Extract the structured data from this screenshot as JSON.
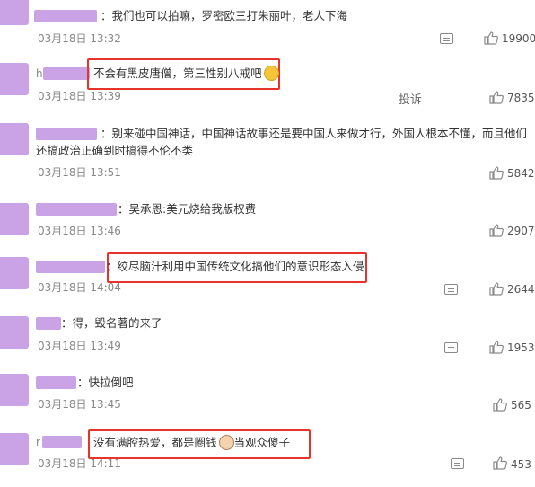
{
  "comments": [
    {
      "name_prefix": "",
      "text": "我们也可以拍嘛，罗密欧三打朱丽叶，老人下海",
      "time": "03月18日 13:32",
      "likes": "19900"
    },
    {
      "name_prefix": "h",
      "text": "不会有黑皮唐僧，第三性别八戒吧",
      "time": "03月18日 13:39",
      "report_label": "投诉",
      "likes": "7835",
      "emoji": "laughing-emoji"
    },
    {
      "name_prefix": "",
      "text": "别来碰中国神话，中国神话故事还是要中国人来做才行，外国人根本不懂，而且他们还搞政治正确到时搞得不伦不类",
      "time": "03月18日 13:51",
      "likes": "5842"
    },
    {
      "name_prefix": "",
      "text": "吴承恩:美元烧给我版权费",
      "time": "03月18日 13:46",
      "likes": "2907"
    },
    {
      "name_prefix": "",
      "text": "绞尽脑汁利用中国传统文化搞他们的意识形态入侵",
      "time": "03月18日 14:04",
      "likes": "2644"
    },
    {
      "name_prefix": "",
      "text": "得，毁名著的来了",
      "time": "03月18日 13:49",
      "likes": "1953"
    },
    {
      "name_prefix": "",
      "text": "快拉倒吧",
      "time": "03月18日 13:45",
      "likes": "565"
    },
    {
      "name_prefix": "r",
      "text_before": "没有满腔热爱，都是圈钱",
      "text_after": "当观众傻子",
      "time": "03月18日 14:11",
      "likes": "453",
      "emoji": "face-emoji"
    }
  ],
  "icons": {
    "reply": "reply-icon",
    "like": "thumbs-up-icon"
  },
  "colors": {
    "highlight_box": "#e8332a",
    "redaction": "#c9a3e6"
  }
}
